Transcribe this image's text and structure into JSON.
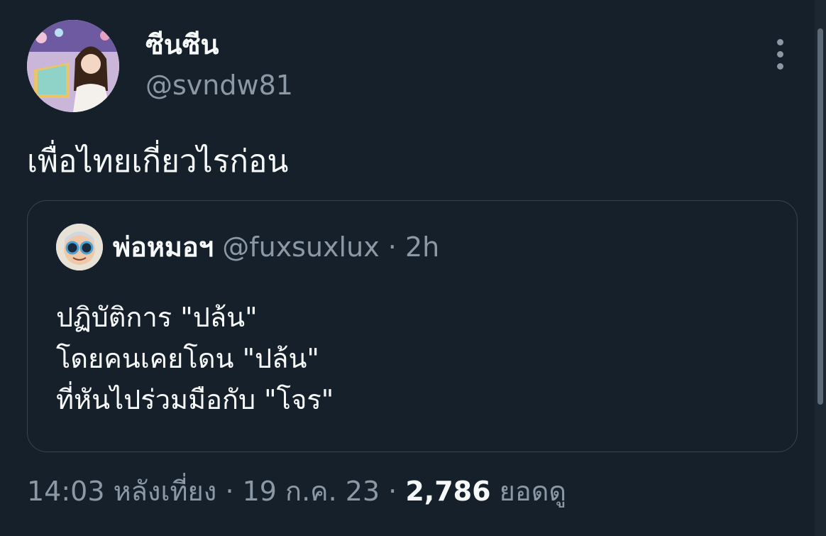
{
  "author": {
    "display_name": "ซีนซีน",
    "handle": "@svndw81"
  },
  "tweet": {
    "text": "เพื่อไทยเกี่ยวไรก่อน"
  },
  "quoted_tweet": {
    "display_name": "พ่อหมอฯ",
    "handle": "@fuxsuxlux",
    "separator": "·",
    "time": "2h",
    "lines": [
      "ปฏิบัติการ \"ปล้น\"",
      "โดยคนเคยโดน \"ปล้น\"",
      "ที่หันไปร่วมมือกับ \"โจร\""
    ]
  },
  "meta": {
    "time": "14:03 หลังเที่ยง",
    "separator": "·",
    "date": "19 ก.ค. 23",
    "views_count": "2,786",
    "views_label": "ยอดดู"
  },
  "icons": {
    "more": "more-vertical-icon"
  },
  "colors": {
    "background": "#15202b",
    "primary_text": "#f7f9f9",
    "secondary_text": "#8b98a5",
    "border": "#38444d"
  }
}
